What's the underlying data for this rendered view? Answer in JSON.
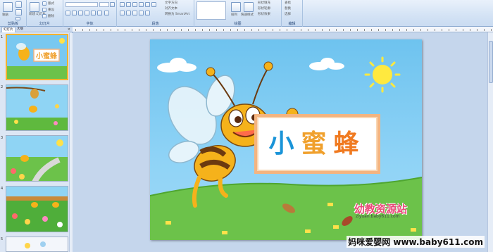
{
  "ribbon": {
    "groups": [
      "剪贴板",
      "幻灯片",
      "字体",
      "段落",
      "绘图",
      "编辑"
    ],
    "buttons": {
      "paste": "粘贴",
      "new_slide": "新建\n幻灯片",
      "layout": "版式",
      "reset": "重设",
      "delete": "删除",
      "text_direction": "文字方向",
      "align_text": "对齐文本",
      "smartart": "转换为 SmartArt",
      "arrange": "排列",
      "quick_styles": "快速样式",
      "shape_fill": "形状填充",
      "shape_outline": "形状轮廓",
      "shape_effects": "形状效果",
      "find": "查找",
      "replace": "替换",
      "select": "选择"
    }
  },
  "panel": {
    "tabs": [
      "幻灯片",
      "大纲"
    ],
    "close": "×",
    "slides": [
      {
        "num": "1",
        "title": "小蜜蜂"
      },
      {
        "num": "2"
      },
      {
        "num": "3"
      },
      {
        "num": "4"
      },
      {
        "num": "5"
      }
    ]
  },
  "slide": {
    "title_chars": [
      "小",
      "蜜",
      "蜂"
    ],
    "logo": "幼教资源站",
    "logo_url": "ziyuan.baby611.com"
  },
  "watermark": "妈咪爱婴网 www.baby611.com",
  "colors": {
    "title_blue": "#1a94d8",
    "title_orange": "#f0a02c",
    "title_card_border": "#f4b480",
    "sky": "#6ec3ef",
    "grass": "#6cc24a",
    "selection": "#f4b22d"
  }
}
